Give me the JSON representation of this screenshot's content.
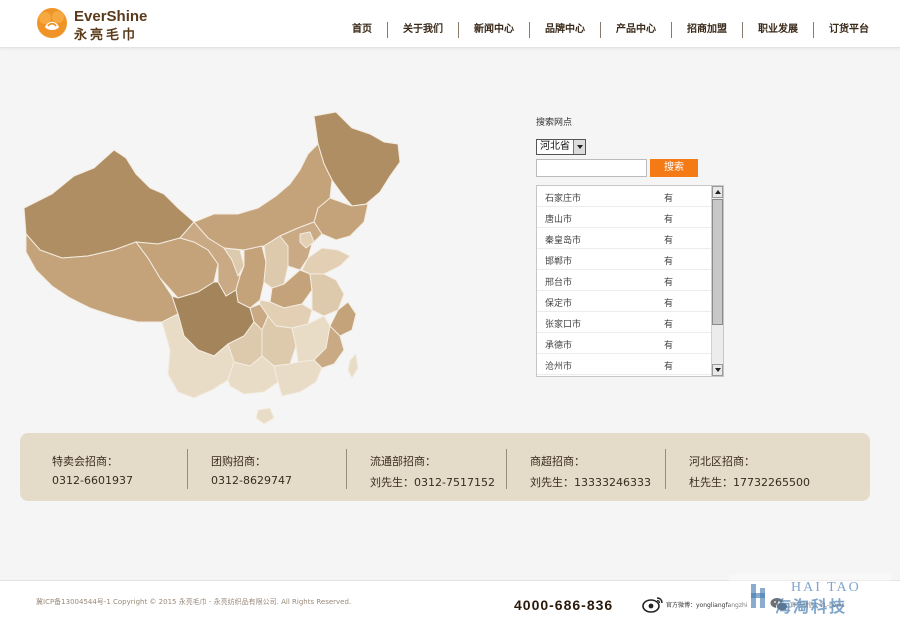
{
  "header": {
    "brand_en": "EverShine",
    "brand_cn": "永亮毛巾",
    "nav": [
      "首页",
      "关于我们",
      "新闻中心",
      "品牌中心",
      "产品中心",
      "招商加盟",
      "职业发展",
      "订货平台"
    ]
  },
  "search": {
    "title": "搜索网点",
    "province": "河北省",
    "input_value": "",
    "button_label": "搜索"
  },
  "cities": [
    {
      "name": "石家庄市",
      "status": "有"
    },
    {
      "name": "唐山市",
      "status": "有"
    },
    {
      "name": "秦皇岛市",
      "status": "有"
    },
    {
      "name": "邯郸市",
      "status": "有"
    },
    {
      "name": "邢台市",
      "status": "有"
    },
    {
      "name": "保定市",
      "status": "有"
    },
    {
      "name": "张家口市",
      "status": "有"
    },
    {
      "name": "承德市",
      "status": "有"
    },
    {
      "name": "沧州市",
      "status": "有"
    }
  ],
  "contacts": [
    {
      "title": "特卖会招商：",
      "phone": "0312-6601937"
    },
    {
      "title": "团购招商：",
      "phone": "0312-8629747"
    },
    {
      "title": "流通部招商：",
      "phone": "刘先生：0312-7517152"
    },
    {
      "title": "商超招商：",
      "phone": "刘先生：13333246333"
    },
    {
      "title": "河北区招商：",
      "phone": "杜先生：17732265500"
    }
  ],
  "footer": {
    "copyright": "冀ICP备13004544号-1 Copyright © 2015 永亮毛巾 - 永亮纺织品有限公司. All Rights Reserved.",
    "hotline": "4000-686-836",
    "weibo_label": "官方微博：yongliangfangzhi",
    "wechat_label": "官方微信：YL-news"
  },
  "watermark": {
    "line1": "HAI TAO",
    "line2": "海淘科技"
  },
  "colors": {
    "accent": "#f47a16",
    "brand": "#5a3a1a",
    "contact_bg": "#e4dbc9",
    "map_dark": "#b08e63",
    "map_mid": "#c4a27a",
    "map_light": "#e2cfb4"
  }
}
